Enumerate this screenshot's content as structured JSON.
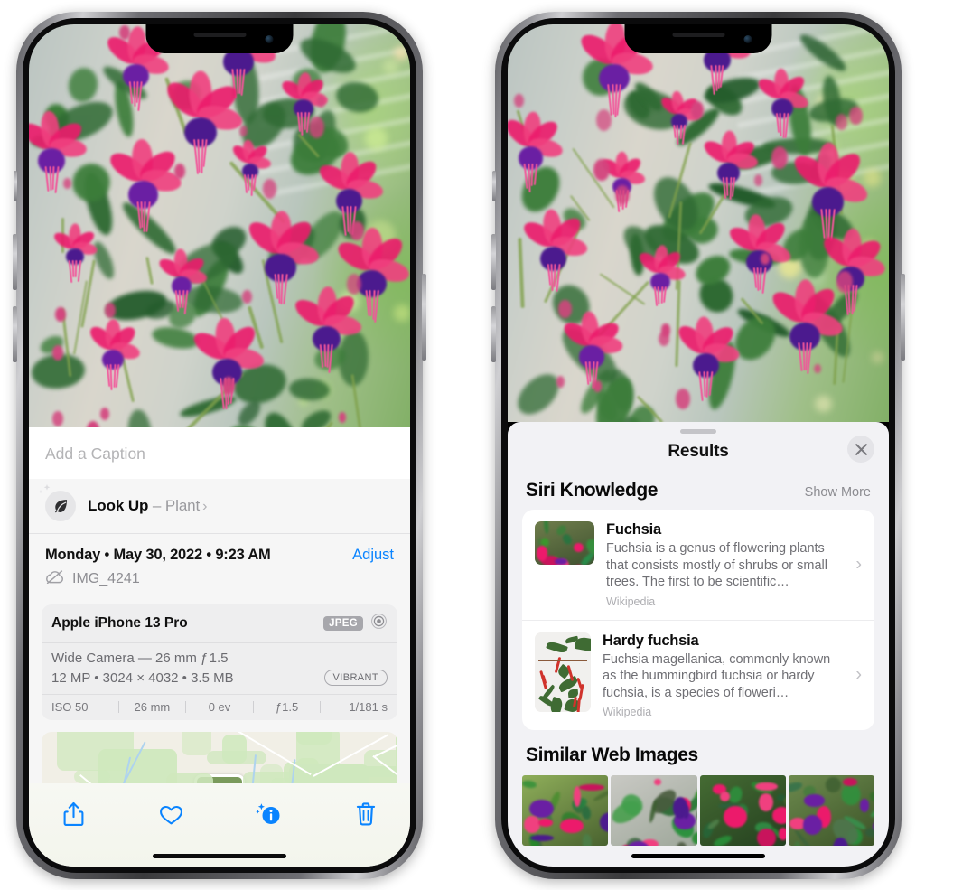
{
  "page": {
    "background": "#ffffff"
  },
  "left_phone": {
    "name": "iPhone 13 Pro — Photos detail view",
    "caption_placeholder": "Add a Caption",
    "lookup": {
      "label": "Look Up",
      "dash": " – ",
      "subject": "Plant",
      "chevron": "›",
      "icon": "leaf-icon"
    },
    "metadata": {
      "date": "Monday • May 30, 2022 • 9:23 AM",
      "adjust_label": "Adjust",
      "filename": "IMG_4241",
      "cloud_icon": "cloud-slash-icon"
    },
    "exif": {
      "device": "Apple iPhone 13 Pro",
      "format_badge": "JPEG",
      "lens_icon": "aperture-icon",
      "lens_line": "Wide Camera — 26 mm ƒ 1.5",
      "size_line": "12 MP • 3024 × 4032 • 3.5 MB",
      "style_pill": "VIBRANT",
      "stats": [
        "ISO 50",
        "26 mm",
        "0 ev",
        "ƒ1.5",
        "1/181 s"
      ]
    },
    "toolbar": [
      {
        "name": "share-button",
        "icon": "share-icon",
        "color": "#0a84ff"
      },
      {
        "name": "favorite-button",
        "icon": "heart-icon",
        "color": "#0a84ff"
      },
      {
        "name": "info-button",
        "icon": "info-sparkle-icon",
        "color": "#0a84ff"
      },
      {
        "name": "delete-button",
        "icon": "trash-icon",
        "color": "#0a84ff"
      }
    ]
  },
  "right_phone": {
    "name": "iPhone 13 Pro — Visual Look Up results",
    "photo_badge": {
      "icon": "leaf-icon",
      "label": "plant-detected-badge"
    },
    "sheet": {
      "title": "Results",
      "close_icon": "close-icon",
      "sections": [
        {
          "title": "Siri Knowledge",
          "action": "Show More",
          "items": [
            {
              "title": "Fuchsia",
              "description": "Fuchsia is a genus of flowering plants that consists mostly of shrubs or small trees. The first to be scientific…",
              "source": "Wikipedia",
              "thumbnail": "red-fuchsia-photo",
              "chevron": "›"
            },
            {
              "title": "Hardy fuchsia",
              "description": "Fuchsia magellanica, commonly known as the hummingbird fuchsia or hardy fuchsia, is a species of floweri…",
              "source": "Wikipedia",
              "thumbnail": "hardy-fuchsia-specimen-photo",
              "chevron": "›"
            }
          ]
        },
        {
          "title": "Similar Web Images",
          "items": [
            {
              "thumbnail": "fuchsia-web-image-1"
            },
            {
              "thumbnail": "fuchsia-web-image-2"
            },
            {
              "thumbnail": "fuchsia-web-image-3"
            },
            {
              "thumbnail": "fuchsia-web-image-4"
            }
          ]
        }
      ]
    }
  },
  "colors": {
    "accent_blue": "#0a84ff",
    "sheet_gray": "#f2f2f5",
    "card_white": "#ffffff",
    "secondary_text": "#8e8e93"
  }
}
